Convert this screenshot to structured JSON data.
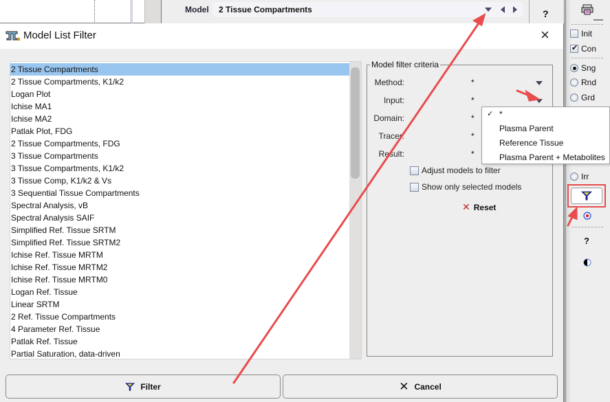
{
  "background_app": {
    "model_label": "Model",
    "model_value": "2 Tissue Compartments",
    "help_label": "?"
  },
  "right_toolbar": {
    "checkboxes": [
      {
        "label": "Init",
        "checked": false
      },
      {
        "label": "Con",
        "checked": true
      }
    ],
    "radios": [
      {
        "label": "Sng",
        "checked": true
      },
      {
        "label": "Rnd",
        "checked": false
      },
      {
        "label": "Grd",
        "checked": false
      },
      {
        "label": "Irr",
        "checked": false
      }
    ],
    "help_label": "?"
  },
  "dialog": {
    "title": "Model List Filter",
    "models": [
      "2 Tissue Compartments",
      "2 Tissue Compartments, K1/k2",
      "Logan Plot",
      "Ichise MA1",
      "Ichise MA2",
      "Patlak Plot, FDG",
      "2 Tissue Compartments, FDG",
      "3 Tissue Compartments",
      "3 Tissue Compartments, K1/k2",
      "3 Tissue Comp, K1/k2 & Vs",
      "3 Sequential Tissue Compartments",
      "Spectral Analysis, vB",
      "Spectral Analysis SAIF",
      "Simplified Ref. Tissue SRTM",
      "Simplified Ref. Tissue SRTM2",
      "Ichise Ref. Tissue MRTM",
      "Ichise Ref. Tissue MRTM2",
      "Ichise Ref. Tissue MRTM0",
      "Logan Ref. Tissue",
      "Linear SRTM",
      "2 Ref. Tissue Compartments",
      "4 Parameter Ref. Tissue",
      "Patlak Ref. Tissue",
      "Partial Saturation, data-driven"
    ],
    "selected_model": "2 Tissue Compartments",
    "criteria": {
      "legend": "Model filter criteria",
      "rows": [
        {
          "label": "Method:",
          "value": "*"
        },
        {
          "label": "Input:",
          "value": "*"
        },
        {
          "label": "Domain:",
          "value": "*"
        },
        {
          "label": "Tracer:",
          "value": "*"
        },
        {
          "label": "Result:",
          "value": "*"
        }
      ],
      "adjust_models_label": "Adjust models to filter",
      "adjust_models_checked": false,
      "show_selected_label": "Show only selected models",
      "show_selected_checked": false,
      "reset_label": "Reset"
    },
    "input_dropdown_options": [
      {
        "label": "*",
        "checked": true
      },
      {
        "label": "Plasma Parent",
        "checked": false
      },
      {
        "label": "Reference Tissue",
        "checked": false
      },
      {
        "label": "Plasma Parent + Metabolites",
        "checked": false
      }
    ],
    "filter_button_label": "Filter",
    "cancel_button_label": "Cancel",
    "close_symbol": "×"
  },
  "colors": {
    "selection": "#99c6ef",
    "annotation_arrow": "#e84c4c",
    "reset_icon": "#c0272d",
    "filter_icon": "#1a2fb0"
  }
}
